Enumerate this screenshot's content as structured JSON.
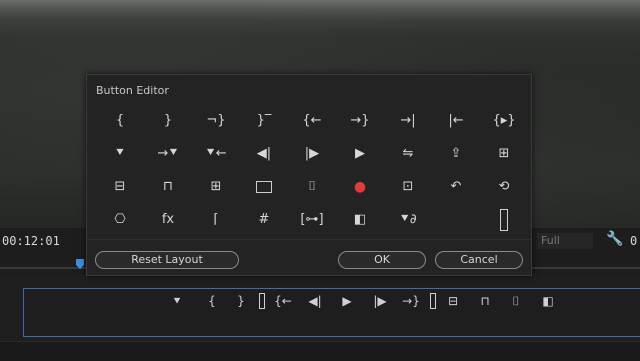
{
  "dialog": {
    "title": "Button Editor",
    "reset_label": "Reset Layout",
    "ok_label": "OK",
    "cancel_label": "Cancel"
  },
  "monitor": {
    "timecode_left": "00:12:01",
    "timecode_right": "0",
    "fit_value": "Full"
  },
  "grid_buttons": [
    {
      "glyph": "{",
      "name": "mark-in-icon"
    },
    {
      "glyph": "}",
      "name": "mark-out-icon"
    },
    {
      "glyph": "¬}",
      "name": "mark-clip-icon"
    },
    {
      "glyph": "}‾",
      "name": "add-marker-icon"
    },
    {
      "glyph": "{←",
      "name": "go-to-in-icon"
    },
    {
      "glyph": "→}",
      "name": "go-to-out-icon"
    },
    {
      "glyph": "→|",
      "name": "go-to-next-edit-icon"
    },
    {
      "glyph": "|←",
      "name": "go-to-previous-edit-icon"
    },
    {
      "glyph": "{▸}",
      "name": "play-in-to-out-icon"
    },
    {
      "glyph": "⯆",
      "name": "add-marker-drop-icon"
    },
    {
      "glyph": "→⯆",
      "name": "go-to-next-marker-icon"
    },
    {
      "glyph": "⯆←",
      "name": "go-to-previous-marker-icon"
    },
    {
      "glyph": "◀|",
      "name": "step-back-icon"
    },
    {
      "glyph": "|▶",
      "name": "step-forward-icon"
    },
    {
      "glyph": "▶",
      "name": "play-stop-icon"
    },
    {
      "glyph": "⇋",
      "name": "shuttle-icon"
    },
    {
      "glyph": "⇪",
      "name": "export-frame-icon"
    },
    {
      "glyph": "⊞",
      "name": "overwrite-icon"
    },
    {
      "glyph": "⊟",
      "name": "lift-icon"
    },
    {
      "glyph": "⊓",
      "name": "extract-icon"
    },
    {
      "glyph": "⊞",
      "name": "insert-icon"
    },
    {
      "glyph": "▭",
      "name": "safe-margins-icon"
    },
    {
      "glyph": "⌷",
      "name": "camera-icon"
    },
    {
      "glyph": "●",
      "name": "record-icon"
    },
    {
      "glyph": "⊡",
      "name": "multi-camera-icon"
    },
    {
      "glyph": "↶",
      "name": "undo-icon"
    },
    {
      "glyph": "⟲",
      "name": "loop-icon"
    },
    {
      "glyph": "⎔",
      "name": "vr-video-icon"
    },
    {
      "glyph": "fx",
      "name": "global-fx-mute-icon"
    },
    {
      "glyph": "⌈",
      "name": "trim-icon"
    },
    {
      "glyph": "#",
      "name": "guides-icon"
    },
    {
      "glyph": "[⊶]",
      "name": "proxy-toggle-icon"
    },
    {
      "glyph": "◧",
      "name": "comparison-view-icon"
    },
    {
      "glyph": "⯆∂",
      "name": "link-marker-icon"
    },
    {
      "glyph": "",
      "name": "empty-slot"
    },
    {
      "glyph": "▯",
      "name": "spacer-icon"
    }
  ],
  "bar_buttons": [
    {
      "glyph": "⯆",
      "name": "add-marker-icon"
    },
    {
      "glyph": "{",
      "name": "mark-in-icon"
    },
    {
      "glyph": "}",
      "name": "mark-out-icon"
    },
    {
      "glyph": "▯",
      "name": "spacer-icon"
    },
    {
      "glyph": "{←",
      "name": "go-to-in-icon"
    },
    {
      "glyph": "◀|",
      "name": "step-back-icon"
    },
    {
      "glyph": "▶",
      "name": "play-stop-icon"
    },
    {
      "glyph": "|▶",
      "name": "step-forward-icon"
    },
    {
      "glyph": "→}",
      "name": "go-to-out-icon"
    },
    {
      "glyph": "▯",
      "name": "spacer-icon"
    },
    {
      "glyph": "⊟",
      "name": "lift-icon"
    },
    {
      "glyph": "⊓",
      "name": "extract-icon"
    },
    {
      "glyph": "⌷",
      "name": "camera-icon"
    },
    {
      "glyph": "◧",
      "name": "comparison-view-icon"
    }
  ]
}
